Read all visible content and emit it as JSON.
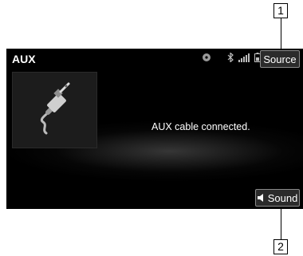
{
  "callouts": {
    "top": "1",
    "bottom": "2"
  },
  "header": {
    "title": "AUX",
    "source_label": "Source"
  },
  "status_icons": [
    "disc-icon",
    "bluetooth-icon",
    "signal-bars-icon",
    "battery-icon"
  ],
  "main": {
    "artwork_icon": "aux-cable-icon",
    "message": "AUX cable connected."
  },
  "footer": {
    "sound_label": "Sound",
    "sound_icon": "speaker-icon"
  },
  "colors": {
    "screen_bg": "#000000",
    "text": "#ffffff",
    "button_bg": "#2b2b2b",
    "button_border": "#8a8a8a"
  }
}
